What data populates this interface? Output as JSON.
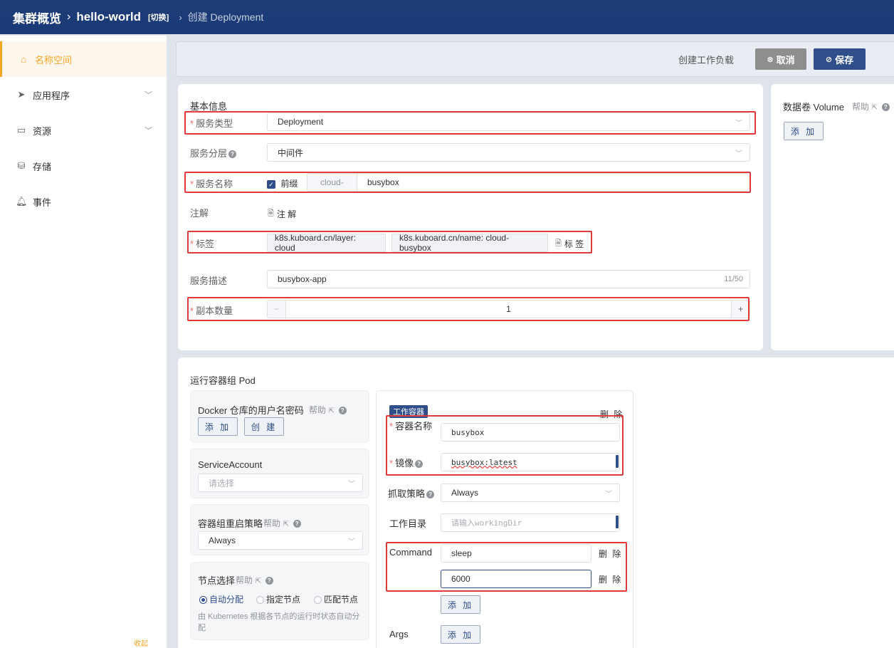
{
  "topbar": {
    "cluster": "集群概览",
    "namespace": "hello-world",
    "switch": "[切换]",
    "page": "创建 Deployment"
  },
  "sidebar": {
    "items": [
      {
        "label": "名称空间",
        "icon": "home-icon",
        "active": true
      },
      {
        "label": "应用程序",
        "icon": "send-icon",
        "expandable": true
      },
      {
        "label": "资源",
        "icon": "box-icon",
        "expandable": true
      },
      {
        "label": "存储",
        "icon": "database-icon"
      },
      {
        "label": "事件",
        "icon": "bell-icon"
      }
    ],
    "footer": "收起"
  },
  "actionbar": {
    "title": "创建工作负载",
    "cancel": "取消",
    "save": "保存"
  },
  "basic": {
    "section": "基本信息",
    "service_type_label": "服务类型",
    "service_type_value": "Deployment",
    "layer_label": "服务分层",
    "layer_value": "中间件",
    "name_label": "服务名称",
    "prefix_checkbox": "前缀",
    "prefix_value": "cloud-",
    "name_value": "busybox",
    "annotation_label": "注解",
    "annotation_btn": "注 解",
    "labels_label": "标签",
    "labels": [
      "k8s.kuboard.cn/layer: cloud",
      "k8s.kuboard.cn/name: cloud-busybox"
    ],
    "labels_btn": "标 签",
    "desc_label": "服务描述",
    "desc_value": "busybox-app",
    "desc_count": "11/50",
    "replicas_label": "副本数量",
    "replicas_value": "1",
    "minus": "−",
    "plus": "+"
  },
  "volume": {
    "title": "数据卷 Volume",
    "help": "帮助",
    "add": "添 加"
  },
  "pod": {
    "section": "运行容器组 Pod",
    "docker": {
      "title": "Docker 仓库的用户名密码",
      "help": "帮助",
      "add": "添 加",
      "create": "创 建"
    },
    "service_account": {
      "title": "ServiceAccount",
      "placeholder": "请选择"
    },
    "restart": {
      "title": "容器组重启策略",
      "help": "帮助",
      "value": "Always"
    },
    "node": {
      "title": "节点选择",
      "help": "帮助",
      "options": [
        "自动分配",
        "指定节点",
        "匹配节点"
      ],
      "selected": 0,
      "desc": "由 Kubernetes 根据各节点的运行时状态自动分配"
    },
    "container": {
      "tag": "工作容器",
      "delete": "删 除",
      "name_label": "容器名称",
      "name_value": "busybox",
      "image_label": "镜像",
      "image_value": "busybox:latest",
      "pull_label": "抓取策略",
      "pull_value": "Always",
      "workdir_label": "工作目录",
      "workdir_placeholder": "请输入workingDir",
      "command_label": "Command",
      "commands": [
        "sleep",
        "6000"
      ],
      "cmd_delete": "删 除",
      "cmd_add": "添 加",
      "args_label": "Args",
      "args_add": "添 加"
    }
  }
}
